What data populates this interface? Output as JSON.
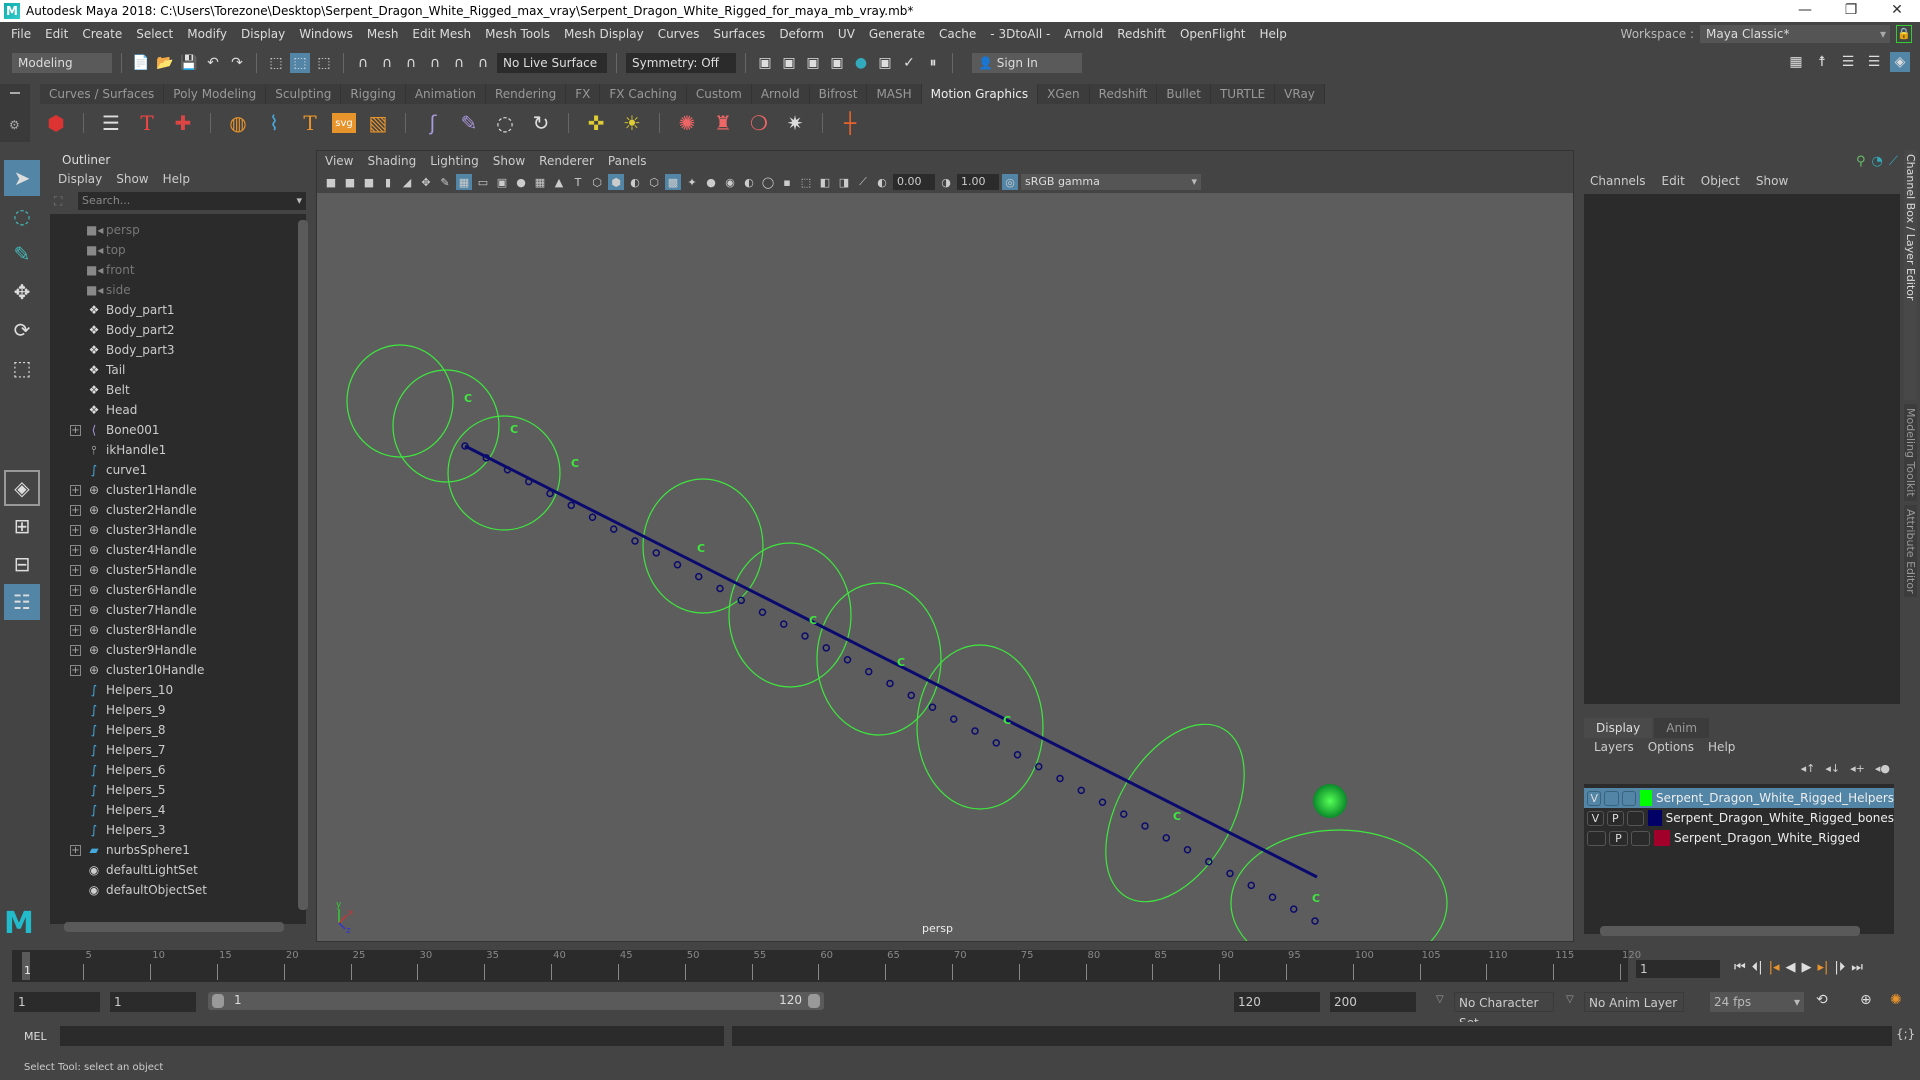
{
  "window": {
    "title": "Autodesk Maya 2018: C:\\Users\\Torezone\\Desktop\\Serpent_Dragon_White_Rigged_max_vray\\Serpent_Dragon_White_Rigged_for_maya_mb_vray.mb*",
    "minimize": "—",
    "maximize": "❐",
    "close": "✕"
  },
  "menubar": [
    "File",
    "Edit",
    "Create",
    "Select",
    "Modify",
    "Display",
    "Windows",
    "Mesh",
    "Edit Mesh",
    "Mesh Tools",
    "Mesh Display",
    "Curves",
    "Surfaces",
    "Deform",
    "UV",
    "Generate",
    "Cache",
    "- 3DtoAll -",
    "Arnold",
    "Redshift",
    "OpenFlight",
    "Help"
  ],
  "workspace": {
    "label": "Workspace :",
    "value": "Maya Classic*"
  },
  "statusline": {
    "menuset": "Modeling",
    "live_surface": "No Live Surface",
    "symmetry": "Symmetry: Off",
    "sign_in": "Sign In"
  },
  "shelf": {
    "tabs": [
      "Curves / Surfaces",
      "Poly Modeling",
      "Sculpting",
      "Rigging",
      "Animation",
      "Rendering",
      "FX",
      "FX Caching",
      "Custom",
      "Arnold",
      "Bifrost",
      "MASH",
      "Motion Graphics",
      "XGen",
      "Redshift",
      "Bullet",
      "TURTLE",
      "VRay"
    ],
    "active_tab": "Motion Graphics"
  },
  "outliner": {
    "title": "Outliner",
    "menu": [
      "Display",
      "Show",
      "Help"
    ],
    "search_placeholder": "Search...",
    "items": [
      {
        "label": "persp",
        "icon": "camera-icon",
        "dim": true,
        "expandable": false
      },
      {
        "label": "top",
        "icon": "camera-icon",
        "dim": true,
        "expandable": false
      },
      {
        "label": "front",
        "icon": "camera-icon",
        "dim": true,
        "expandable": false
      },
      {
        "label": "side",
        "icon": "camera-icon",
        "dim": true,
        "expandable": false
      },
      {
        "label": "Body_part1",
        "icon": "mesh-icon",
        "dim": false,
        "expandable": false
      },
      {
        "label": "Body_part2",
        "icon": "mesh-icon",
        "dim": false,
        "expandable": false
      },
      {
        "label": "Body_part3",
        "icon": "mesh-icon",
        "dim": false,
        "expandable": false
      },
      {
        "label": "Tail",
        "icon": "mesh-icon",
        "dim": false,
        "expandable": false
      },
      {
        "label": "Belt",
        "icon": "mesh-icon",
        "dim": false,
        "expandable": false
      },
      {
        "label": "Head",
        "icon": "mesh-icon",
        "dim": false,
        "expandable": false
      },
      {
        "label": "Bone001",
        "icon": "joint-icon",
        "dim": false,
        "expandable": true
      },
      {
        "label": "ikHandle1",
        "icon": "ik-handle-icon",
        "dim": false,
        "expandable": false
      },
      {
        "label": "curve1",
        "icon": "curve-icon",
        "dim": false,
        "expandable": false
      },
      {
        "label": "cluster1Handle",
        "icon": "cluster-icon",
        "dim": false,
        "expandable": true
      },
      {
        "label": "cluster2Handle",
        "icon": "cluster-icon",
        "dim": false,
        "expandable": true
      },
      {
        "label": "cluster3Handle",
        "icon": "cluster-icon",
        "dim": false,
        "expandable": true
      },
      {
        "label": "cluster4Handle",
        "icon": "cluster-icon",
        "dim": false,
        "expandable": true
      },
      {
        "label": "cluster5Handle",
        "icon": "cluster-icon",
        "dim": false,
        "expandable": true
      },
      {
        "label": "cluster6Handle",
        "icon": "cluster-icon",
        "dim": false,
        "expandable": true
      },
      {
        "label": "cluster7Handle",
        "icon": "cluster-icon",
        "dim": false,
        "expandable": true
      },
      {
        "label": "cluster8Handle",
        "icon": "cluster-icon",
        "dim": false,
        "expandable": true
      },
      {
        "label": "cluster9Handle",
        "icon": "cluster-icon",
        "dim": false,
        "expandable": true
      },
      {
        "label": "cluster10Handle",
        "icon": "cluster-icon",
        "dim": false,
        "expandable": true
      },
      {
        "label": "Helpers_10",
        "icon": "curve-icon",
        "dim": false,
        "expandable": false
      },
      {
        "label": "Helpers_9",
        "icon": "curve-icon",
        "dim": false,
        "expandable": false
      },
      {
        "label": "Helpers_8",
        "icon": "curve-icon",
        "dim": false,
        "expandable": false
      },
      {
        "label": "Helpers_7",
        "icon": "curve-icon",
        "dim": false,
        "expandable": false
      },
      {
        "label": "Helpers_6",
        "icon": "curve-icon",
        "dim": false,
        "expandable": false
      },
      {
        "label": "Helpers_5",
        "icon": "curve-icon",
        "dim": false,
        "expandable": false
      },
      {
        "label": "Helpers_4",
        "icon": "curve-icon",
        "dim": false,
        "expandable": false
      },
      {
        "label": "Helpers_3",
        "icon": "curve-icon",
        "dim": false,
        "expandable": false
      },
      {
        "label": "nurbsSphere1",
        "icon": "nurbs-icon",
        "dim": false,
        "expandable": true
      },
      {
        "label": "defaultLightSet",
        "icon": "set-icon",
        "dim": false,
        "expandable": false
      },
      {
        "label": "defaultObjectSet",
        "icon": "set-icon",
        "dim": false,
        "expandable": false
      }
    ]
  },
  "viewport": {
    "menu": [
      "View",
      "Shading",
      "Lighting",
      "Show",
      "Renderer",
      "Panels"
    ],
    "exposure": "0.00",
    "gamma": "1.00",
    "color_space": "sRGB gamma",
    "camera_label": "persp",
    "cluster_marker": "C",
    "axis": {
      "y": "y",
      "x": "x",
      "z": "z"
    },
    "colors": {
      "helper": "#3ee83e",
      "bones": "#0a0a6e",
      "sphere": "#1fd04a"
    }
  },
  "channelbox": {
    "menu": [
      "Channels",
      "Edit",
      "Object",
      "Show"
    ]
  },
  "sidetabs": [
    "Channel Box / Layer Editor",
    "Modeling Toolkit",
    "Attribute Editor"
  ],
  "layers": {
    "tabs": [
      "Display",
      "Anim"
    ],
    "menu": [
      "Layers",
      "Options",
      "Help"
    ],
    "rows": [
      {
        "v": "V",
        "p": "",
        "name": "Serpent_Dragon_White_Rigged_Helpers",
        "color": "#00ff00",
        "selected": true
      },
      {
        "v": "V",
        "p": "P",
        "name": "Serpent_Dragon_White_Rigged_bones",
        "color": "#000066",
        "selected": false
      },
      {
        "v": "",
        "p": "P",
        "name": "Serpent_Dragon_White_Rigged",
        "color": "#a0002a",
        "selected": false
      }
    ]
  },
  "timeslider": {
    "ticks": [
      "5",
      "10",
      "15",
      "20",
      "25",
      "30",
      "35",
      "40",
      "45",
      "50",
      "55",
      "60",
      "65",
      "70",
      "75",
      "80",
      "85",
      "90",
      "95",
      "100",
      "105",
      "110",
      "115",
      "120"
    ],
    "current_marker": "1",
    "current_frame": "1"
  },
  "range": {
    "start": "1",
    "playback_start": "1",
    "slider_start": "1",
    "slider_end": "120",
    "playback_end": "120",
    "end": "200",
    "character_set": "No Character Set",
    "anim_layer": "No Anim Layer",
    "fps": "24 fps"
  },
  "commandline": {
    "label": "MEL"
  },
  "helpline": "Select Tool: select an object"
}
